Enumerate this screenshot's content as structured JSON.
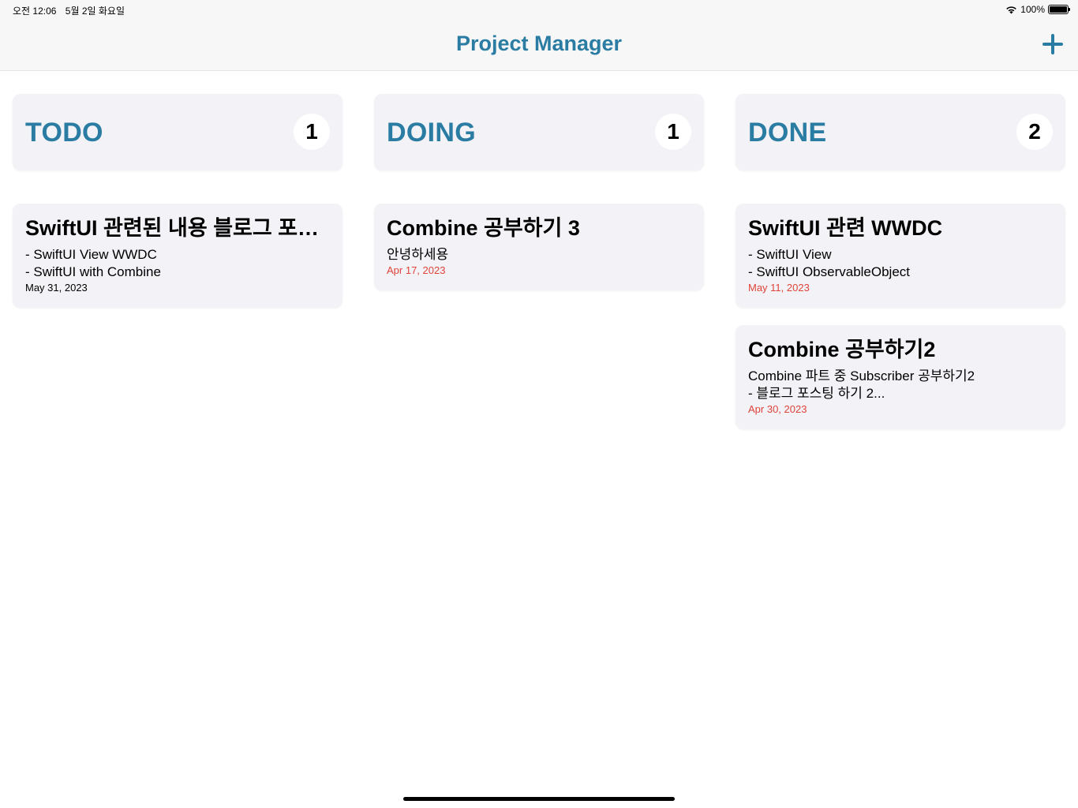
{
  "status_bar": {
    "time": "오전 12:06",
    "date": "5월 2일 화요일",
    "battery": "100%"
  },
  "nav": {
    "title": "Project Manager"
  },
  "columns": [
    {
      "title": "TODO",
      "count": "1",
      "cards": [
        {
          "title": "SwiftUI 관련된 내용 블로그 포…",
          "body": "- SwiftUI View WWDC\n- SwiftUI with Combine",
          "date": "May 31, 2023",
          "overdue": false
        }
      ]
    },
    {
      "title": "DOING",
      "count": "1",
      "cards": [
        {
          "title": "Combine 공부하기 3",
          "body": "안녕하세용",
          "date": "Apr 17, 2023",
          "overdue": true
        }
      ]
    },
    {
      "title": "DONE",
      "count": "2",
      "cards": [
        {
          "title": "SwiftUI 관련 WWDC",
          "body": "- SwiftUI View\n- SwiftUI ObservableObject",
          "date": "May 11, 2023",
          "overdue": true
        },
        {
          "title": "Combine 공부하기2",
          "body": "Combine 파트 중 Subscriber 공부하기2\n- 블로그 포스팅 하기 2...",
          "date": "Apr 30, 2023",
          "overdue": true
        }
      ]
    }
  ],
  "colors": {
    "accent": "#2a7ca3",
    "overdue": "#e0433a",
    "card_background": "#f2f2f7"
  },
  "icons": {
    "add": "plus-icon",
    "wifi": "wifi-icon",
    "battery": "battery-icon"
  }
}
